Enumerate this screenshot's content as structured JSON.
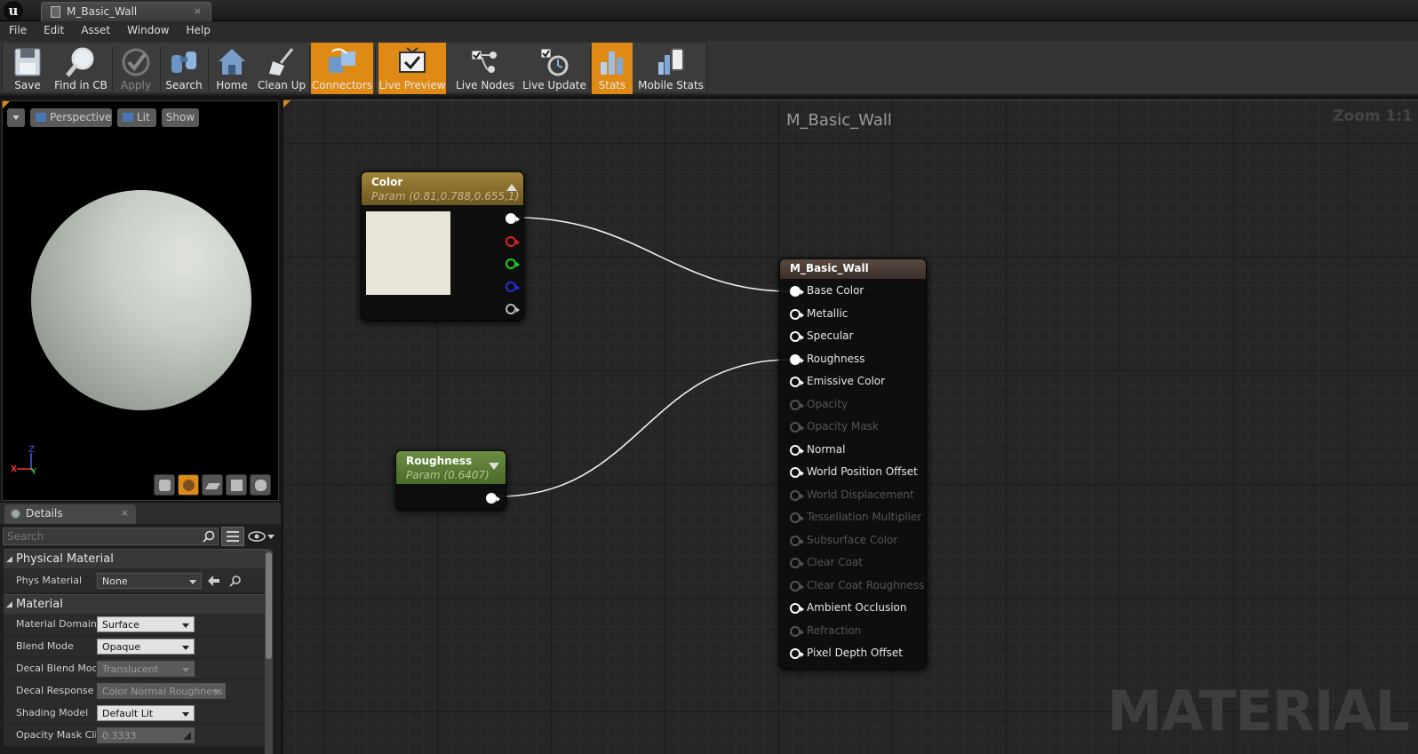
{
  "window": {
    "tab_label": "M_Basic_Wall",
    "tab_close": "×"
  },
  "menu": [
    "File",
    "Edit",
    "Asset",
    "Window",
    "Help"
  ],
  "toolbar": {
    "save": "Save",
    "find_in_cb": "Find in CB",
    "apply": "Apply",
    "search": "Search",
    "home": "Home",
    "clean_up": "Clean Up",
    "connectors": "Connectors",
    "live_preview": "Live Preview",
    "live_nodes": "Live Nodes",
    "live_update": "Live Update",
    "stats": "Stats",
    "mobile_stats": "Mobile Stats",
    "active_color": "#e08a16"
  },
  "viewport": {
    "perspective": "Perspective",
    "lit": "Lit",
    "show": "Show",
    "axis_z": "Z",
    "axis_y": "Y"
  },
  "details": {
    "tab_label": "Details",
    "tab_close": "×",
    "search_placeholder": "Search",
    "categories": {
      "physical_material": "Physical Material",
      "material": "Material"
    },
    "phys_material": {
      "name": "Phys Material",
      "value": "None"
    },
    "properties": [
      {
        "name": "Material Domain",
        "value": "Surface"
      },
      {
        "name": "Blend Mode",
        "value": "Opaque"
      },
      {
        "name": "Decal Blend Mode",
        "value": "Translucent"
      },
      {
        "name": "Decal Response (",
        "value": "Color Normal Roughness"
      },
      {
        "name": "Shading Model",
        "value": "Default Lit"
      },
      {
        "name": "Opacity Mask Cli",
        "value": "0.3333"
      }
    ]
  },
  "graph": {
    "title": "M_Basic_Wall",
    "zoom": "Zoom 1:1",
    "watermark": "MATERIAL",
    "color_node": {
      "title": "Color",
      "subtitle": "Param (0.81,0.788,0.655,1)",
      "swatch": "#ebe7d8",
      "header_color": "#8a6e28"
    },
    "roughness_node": {
      "title": "Roughness",
      "subtitle": "Param (0.6407)",
      "header_color": "#5a7a34"
    },
    "material_node": {
      "title": "M_Basic_Wall",
      "pins": [
        {
          "label": "Base Color",
          "enabled": true,
          "connected": true
        },
        {
          "label": "Metallic",
          "enabled": true,
          "connected": false
        },
        {
          "label": "Specular",
          "enabled": true,
          "connected": false
        },
        {
          "label": "Roughness",
          "enabled": true,
          "connected": true
        },
        {
          "label": "Emissive Color",
          "enabled": true,
          "connected": false
        },
        {
          "label": "Opacity",
          "enabled": false,
          "connected": false
        },
        {
          "label": "Opacity Mask",
          "enabled": false,
          "connected": false
        },
        {
          "label": "Normal",
          "enabled": true,
          "connected": false
        },
        {
          "label": "World Position Offset",
          "enabled": true,
          "connected": false
        },
        {
          "label": "World Displacement",
          "enabled": false,
          "connected": false
        },
        {
          "label": "Tessellation Multiplier",
          "enabled": false,
          "connected": false
        },
        {
          "label": "Subsurface Color",
          "enabled": false,
          "connected": false
        },
        {
          "label": "Clear Coat",
          "enabled": false,
          "connected": false
        },
        {
          "label": "Clear Coat Roughness",
          "enabled": false,
          "connected": false
        },
        {
          "label": "Ambient Occlusion",
          "enabled": true,
          "connected": false
        },
        {
          "label": "Refraction",
          "enabled": false,
          "connected": false
        },
        {
          "label": "Pixel Depth Offset",
          "enabled": true,
          "connected": false
        }
      ]
    }
  }
}
